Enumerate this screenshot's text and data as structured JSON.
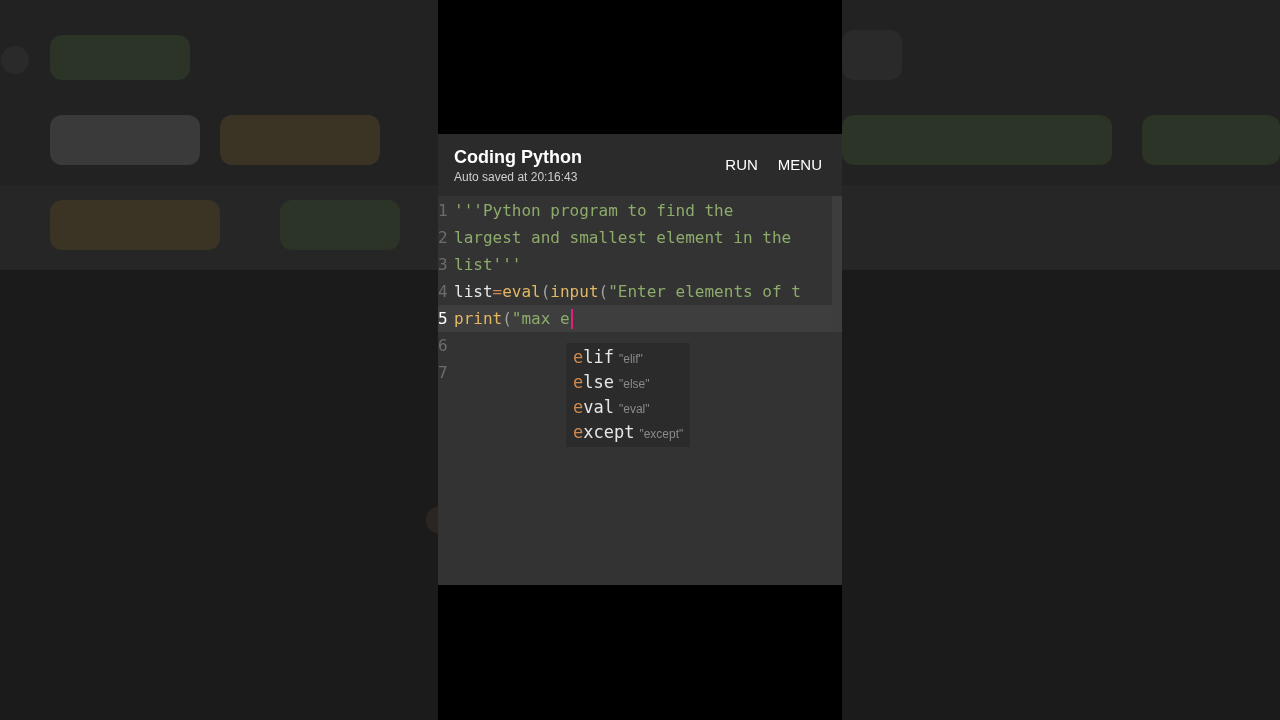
{
  "app_bar": {
    "title": "Coding Python",
    "subtitle": "Auto saved at 20:16:43",
    "actions": [
      "RUN",
      "MENU"
    ]
  },
  "editor": {
    "lines": [
      {
        "number": "1",
        "selected": false,
        "tokens": [
          {
            "kind": "string",
            "text": "'''Python program to find the"
          }
        ]
      },
      {
        "number": "2",
        "selected": false,
        "tokens": [
          {
            "kind": "string",
            "text": "largest and smallest element in the"
          }
        ]
      },
      {
        "number": "3",
        "selected": false,
        "tokens": [
          {
            "kind": "string",
            "text": "list'''"
          }
        ]
      },
      {
        "number": "4",
        "selected": false,
        "tokens": [
          {
            "kind": "name",
            "text": "list"
          },
          {
            "kind": "operator",
            "text": "="
          },
          {
            "kind": "function",
            "text": "eval"
          },
          {
            "kind": "paren",
            "text": "("
          },
          {
            "kind": "function",
            "text": "input"
          },
          {
            "kind": "paren",
            "text": "("
          },
          {
            "kind": "string",
            "text": "\"Enter elements of t"
          }
        ]
      },
      {
        "number": "5",
        "selected": true,
        "tokens": [
          {
            "kind": "function",
            "text": "print"
          },
          {
            "kind": "paren",
            "text": "("
          },
          {
            "kind": "string",
            "text": "\"max e"
          }
        ]
      },
      {
        "number": "6",
        "selected": false
      },
      {
        "number": "7",
        "selected": false
      }
    ]
  },
  "suggestions": [
    {
      "match": "e",
      "rest": "lif",
      "hint": "\"elif\""
    },
    {
      "match": "e",
      "rest": "lse",
      "hint": "\"else\""
    },
    {
      "match": "e",
      "rest": "val",
      "hint": "\"eval\""
    },
    {
      "match": "e",
      "rest": "xcept",
      "hint": "\"except\""
    }
  ]
}
